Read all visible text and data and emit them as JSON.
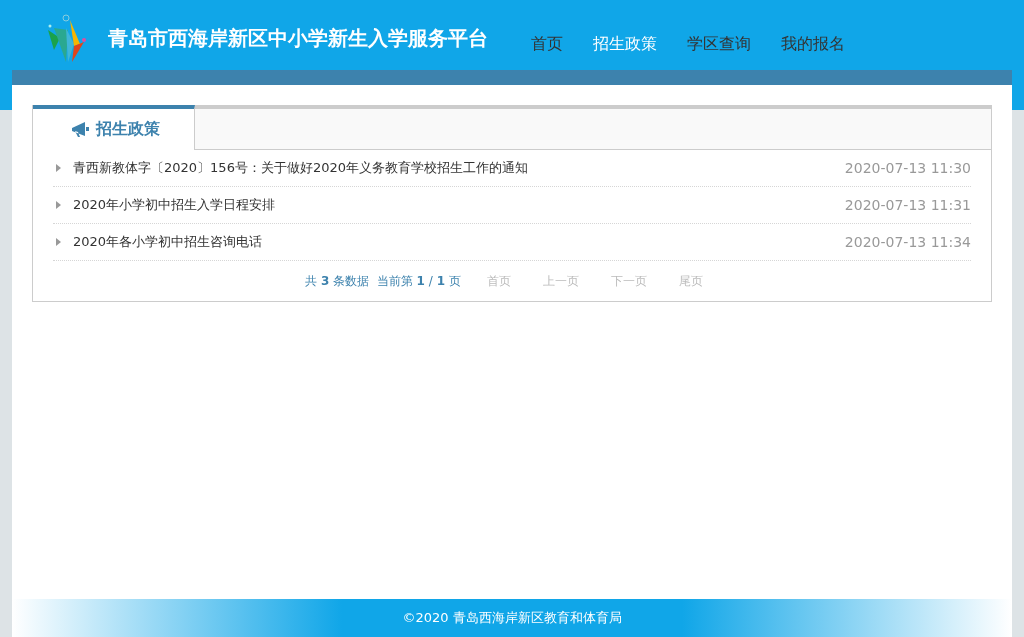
{
  "header": {
    "title": "青岛市西海岸新区中小学新生入学服务平台"
  },
  "nav": [
    {
      "label": "首页",
      "selected": false
    },
    {
      "label": "招生政策",
      "selected": true
    },
    {
      "label": "学区查询",
      "selected": false
    },
    {
      "label": "我的报名",
      "selected": false
    }
  ],
  "panel": {
    "tab": "招生政策",
    "items": [
      {
        "title": "青西新教体字〔2020〕156号：关于做好2020年义务教育学校招生工作的通知",
        "date": "2020-07-13 11:30"
      },
      {
        "title": "2020年小学初中招生入学日程安排",
        "date": "2020-07-13 11:31"
      },
      {
        "title": "2020年各小学初中招生咨询电话",
        "date": "2020-07-13 11:34"
      }
    ],
    "pager": {
      "summary": "共 **3** 条数据  当前第 **1** / **1** 页",
      "links": [
        {
          "label": "首页",
          "disabled": true
        },
        {
          "label": "上一页",
          "disabled": true
        },
        {
          "label": "下一页",
          "disabled": true
        },
        {
          "label": "尾页",
          "disabled": true
        }
      ]
    }
  },
  "footer": "©2020 青岛西海岸新区教育和体育局"
}
